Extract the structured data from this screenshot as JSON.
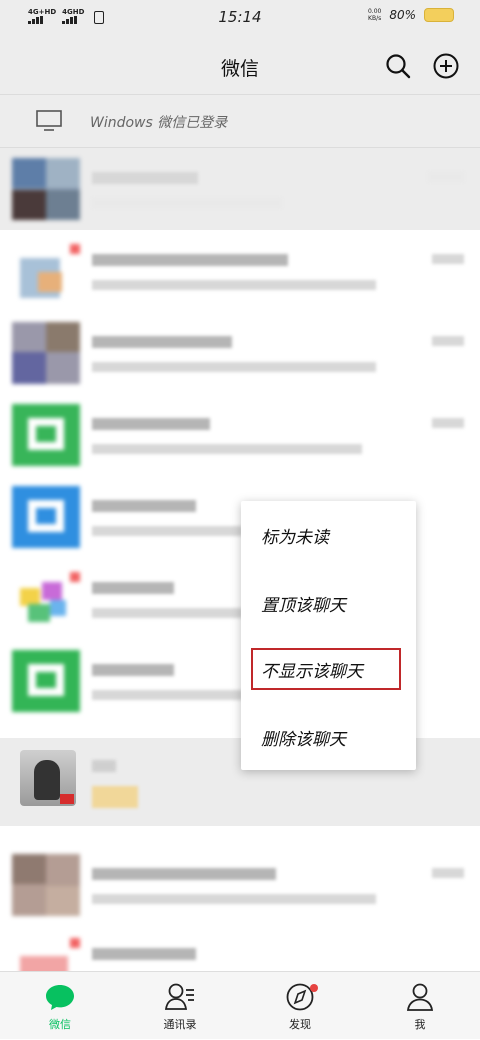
{
  "status_bar": {
    "signal1": "4G+HD",
    "signal2": "4GHD",
    "time": "15:14",
    "speed_line1": "0.00",
    "speed_line2": "KB/s",
    "battery_pct": "80%"
  },
  "header": {
    "title": "微信"
  },
  "login_notice": {
    "text": "Windows 微信已登录"
  },
  "context_menu": {
    "items": [
      "标为未读",
      "置顶该聊天",
      "不显示该聊天",
      "删除该聊天"
    ],
    "highlighted_index": 2
  },
  "tabs": [
    {
      "label": "微信",
      "active": true
    },
    {
      "label": "通讯录",
      "active": false
    },
    {
      "label": "发现",
      "active": false
    },
    {
      "label": "我",
      "active": false
    }
  ],
  "colors": {
    "accent": "#07c160",
    "highlight_border": "#c0282a",
    "badge": "#e64340"
  }
}
